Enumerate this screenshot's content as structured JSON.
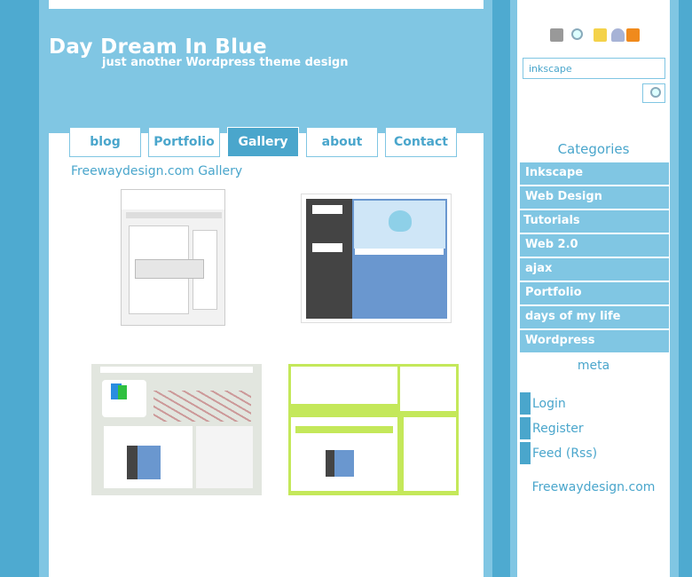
{
  "header": {
    "title": "Day Dream In Blue",
    "tagline": "just another Wordpress theme design"
  },
  "nav": {
    "tabs": [
      {
        "label": "blog"
      },
      {
        "label": "Portfolio"
      },
      {
        "label": "Gallery",
        "active": true
      },
      {
        "label": "about"
      },
      {
        "label": "Contact"
      }
    ]
  },
  "main": {
    "gallery_title": "Freewaydesign.com Gallery",
    "thumbnails": [
      "chili-loter-theme",
      "heart-blue-theme",
      "freewaydesign-theme",
      "hamza-again-theme"
    ]
  },
  "sidebar": {
    "icons": [
      "home-icon",
      "search-icon",
      "note-icon",
      "user-icon",
      "rss-icon"
    ],
    "search": {
      "value": "inkscape"
    },
    "categories_title": "Categories",
    "categories": [
      {
        "label": "Inkscape"
      },
      {
        "label": "Web Design"
      },
      {
        "label": "Tutorials"
      },
      {
        "label": "Web 2.0"
      },
      {
        "label": "ajax"
      },
      {
        "label": "Portfolio"
      },
      {
        "label": "days of my life"
      },
      {
        "label": "Wordpress"
      }
    ],
    "meta_title": "meta",
    "meta": [
      {
        "label": "Login"
      },
      {
        "label": "Register"
      },
      {
        "label": "Feed (Rss)"
      }
    ],
    "footer_link": "Freewaydesign.com"
  },
  "colors": {
    "dark_blue": "#4eaad0",
    "light_blue": "#80c6e3",
    "text_blue": "#4aa6cc",
    "accent_green": "#c4e85a"
  }
}
